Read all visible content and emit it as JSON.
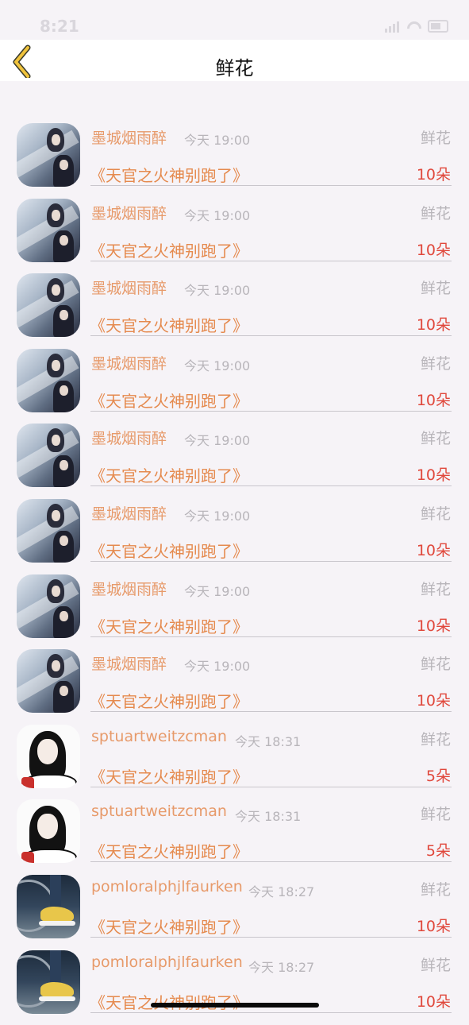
{
  "status_bar": {
    "time": "8:21"
  },
  "nav": {
    "title": "鲜花"
  },
  "colors": {
    "name": "#e79a6a",
    "book": "#e58a4e",
    "quantity": "#e0483c",
    "meta": "#b8b5ba",
    "back_icon": "#f0c33c"
  },
  "rows": [
    {
      "avatar": "anime-figures-avatar",
      "name": "",
      "time": "",
      "gift": "",
      "book": "《天官之火神别跑了》",
      "qty": "10朵"
    },
    {
      "avatar": "anime-figures-avatar",
      "name": "墨城烟雨醉",
      "time": "今天 19:00",
      "gift": "鲜花",
      "book": "《天官之火神别跑了》",
      "qty": "10朵"
    },
    {
      "avatar": "anime-figures-avatar",
      "name": "墨城烟雨醉",
      "time": "今天 19:00",
      "gift": "鲜花",
      "book": "《天官之火神别跑了》",
      "qty": "10朵"
    },
    {
      "avatar": "anime-figures-avatar",
      "name": "墨城烟雨醉",
      "time": "今天 19:00",
      "gift": "鲜花",
      "book": "《天官之火神别跑了》",
      "qty": "10朵"
    },
    {
      "avatar": "anime-figures-avatar",
      "name": "墨城烟雨醉",
      "time": "今天 19:00",
      "gift": "鲜花",
      "book": "《天官之火神别跑了》",
      "qty": "10朵"
    },
    {
      "avatar": "anime-figures-avatar",
      "name": "墨城烟雨醉",
      "time": "今天 19:00",
      "gift": "鲜花",
      "book": "《天官之火神别跑了》",
      "qty": "10朵"
    },
    {
      "avatar": "anime-figures-avatar",
      "name": "墨城烟雨醉",
      "time": "今天 19:00",
      "gift": "鲜花",
      "book": "《天官之火神别跑了》",
      "qty": "10朵"
    },
    {
      "avatar": "anime-figures-avatar",
      "name": "墨城烟雨醉",
      "time": "今天 19:00",
      "gift": "鲜花",
      "book": "《天官之火神别跑了》",
      "qty": "10朵"
    },
    {
      "avatar": "anime-figures-avatar",
      "name": "墨城烟雨醉",
      "time": "今天 19:00",
      "gift": "鲜花",
      "book": "《天官之火神别跑了》",
      "qty": "10朵"
    },
    {
      "avatar": "girl-illustration-avatar",
      "name": "sptuartweitzcman",
      "time": "今天 18:31",
      "gift": "鲜花",
      "book": "《天官之火神别跑了》",
      "qty": "5朵"
    },
    {
      "avatar": "girl-illustration-avatar",
      "name": "sptuartweitzcman",
      "time": "今天 18:31",
      "gift": "鲜花",
      "book": "《天官之火神别跑了》",
      "qty": "5朵"
    },
    {
      "avatar": "sneaker-photo-avatar",
      "name": "pomloralphjlfaurken",
      "time": "今天 18:27",
      "gift": "鲜花",
      "book": "《天官之火神别跑了》",
      "qty": "10朵"
    },
    {
      "avatar": "sneaker-photo-avatar",
      "name": "pomloralphjlfaurken",
      "time": "今天 18:27",
      "gift": "鲜花",
      "book": "《天官之火神别跑了》",
      "qty": "10朵"
    }
  ]
}
